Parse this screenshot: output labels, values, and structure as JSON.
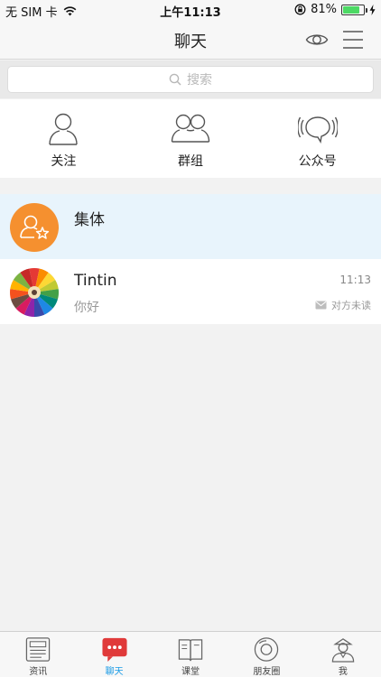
{
  "status_bar": {
    "carrier": "无 SIM 卡",
    "time": "上午11:13",
    "battery": "81%",
    "battery_level": 0.81
  },
  "nav": {
    "title": "聊天",
    "eye_icon": "eye-icon",
    "menu_icon": "menu-icon"
  },
  "search": {
    "placeholder": "搜索",
    "icon": "search-icon"
  },
  "shortcuts": [
    {
      "label": "关注",
      "icon": "person-outline-icon"
    },
    {
      "label": "群组",
      "icon": "group-outline-icon"
    },
    {
      "label": "公众号",
      "icon": "broadcast-icon"
    }
  ],
  "chats": [
    {
      "name": "集体",
      "preview": "",
      "time": "",
      "status": "",
      "avatar": "group-star-avatar",
      "avatar_color": "#f5902f"
    },
    {
      "name": "Tintin",
      "preview": "你好",
      "time": "11:13",
      "status": "对方未读",
      "avatar": "colored-pencils-avatar",
      "status_icon": "envelope-icon"
    }
  ],
  "tabs": [
    {
      "label": "资讯",
      "icon": "newspaper-icon",
      "active": false
    },
    {
      "label": "聊天",
      "icon": "chat-bubble-icon",
      "active": true
    },
    {
      "label": "课堂",
      "icon": "book-icon",
      "active": false
    },
    {
      "label": "朋友圈",
      "icon": "moments-icon",
      "active": false
    },
    {
      "label": "我",
      "icon": "profile-icon",
      "active": false
    }
  ],
  "colors": {
    "accent": "#1a9be6",
    "chat_active_red": "#e03a3a",
    "selected_row": "#e8f4fc",
    "group_avatar": "#f5902f"
  }
}
